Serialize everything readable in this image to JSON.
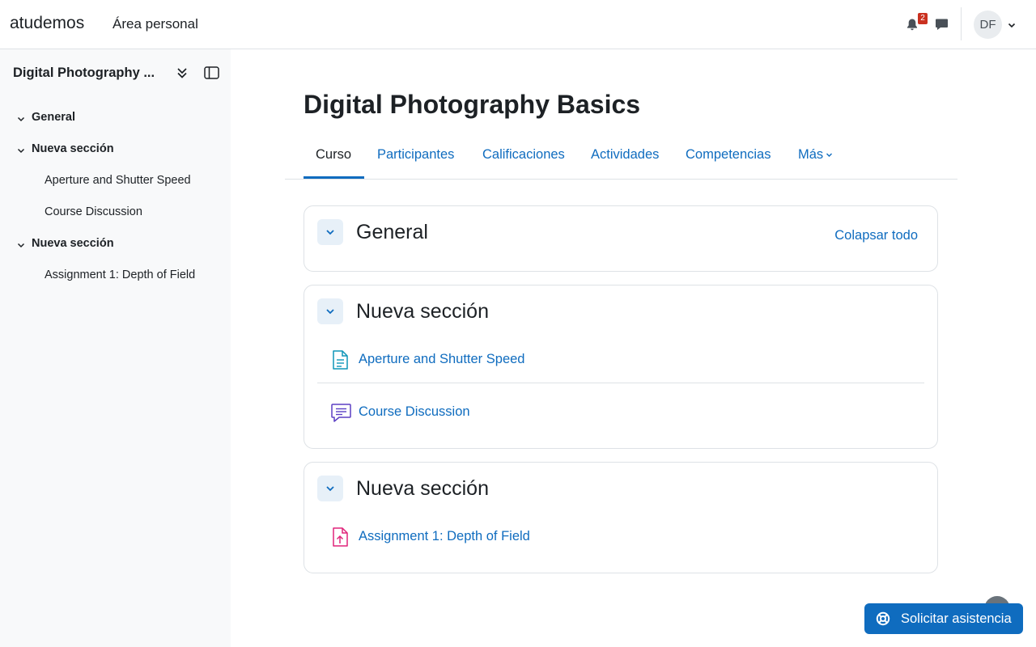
{
  "navbar": {
    "brand": "atudemos",
    "primary_link": "Área personal",
    "notifications_count": "2",
    "avatar_initials": "DF"
  },
  "drawer": {
    "title": "Digital Photography ...",
    "index": [
      {
        "type": "section",
        "label": "General"
      },
      {
        "type": "section",
        "label": "Nueva sección"
      },
      {
        "type": "activity",
        "label": "Aperture and Shutter Speed"
      },
      {
        "type": "activity",
        "label": "Course Discussion"
      },
      {
        "type": "section",
        "label": "Nueva sección"
      },
      {
        "type": "activity",
        "label": "Assignment 1: Depth of Field"
      }
    ]
  },
  "main": {
    "title": "Digital Photography Basics",
    "tabs": [
      "Curso",
      "Participantes",
      "Calificaciones",
      "Actividades",
      "Competencias",
      "Más"
    ],
    "collapse_all": "Colapsar todo",
    "sections": [
      {
        "title": "General",
        "activities": []
      },
      {
        "title": "Nueva sección",
        "activities": [
          {
            "name": "Aperture and Shutter Speed",
            "icon": "page-icon"
          },
          {
            "name": "Course Discussion",
            "icon": "forum-icon"
          }
        ]
      },
      {
        "title": "Nueva sección",
        "activities": [
          {
            "name": "Assignment 1: Depth of Field",
            "icon": "assignment-icon"
          }
        ]
      }
    ]
  },
  "help_button": "Solicitar asistencia",
  "colors": {
    "primary": "#0f6cbf",
    "page_icon": "#0e95b8",
    "forum_icon": "#5b3fc4",
    "assignment_icon": "#e0247a",
    "badge": "#ca3120"
  }
}
